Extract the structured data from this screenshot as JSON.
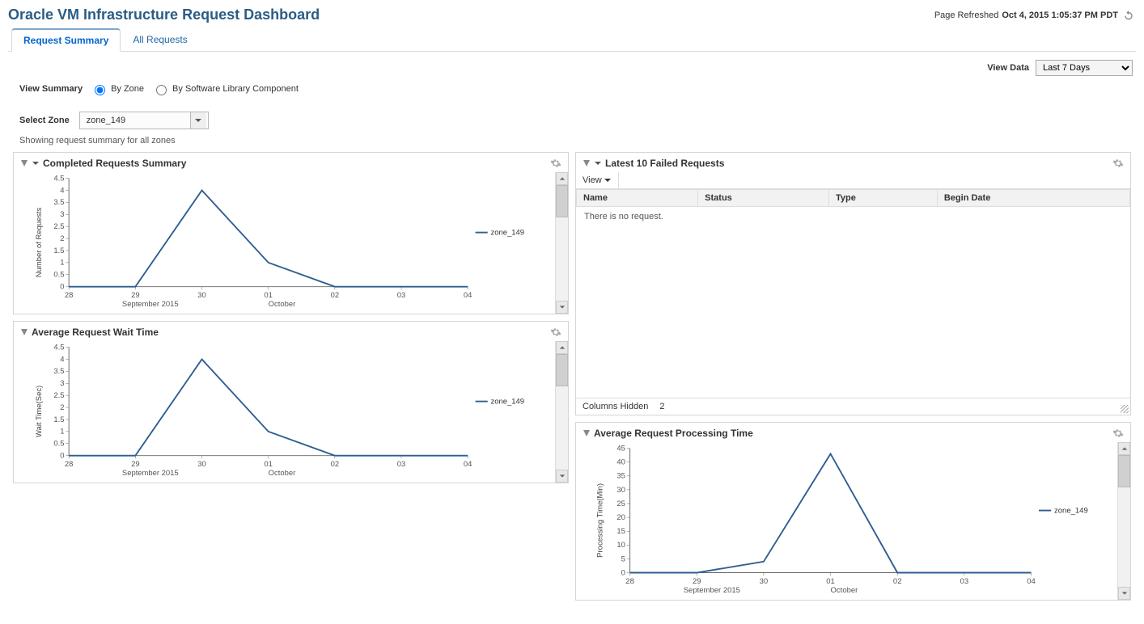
{
  "page": {
    "title": "Oracle VM Infrastructure Request Dashboard",
    "refresh_label": "Page Refreshed",
    "refresh_time": "Oct 4, 2015 1:05:37 PM PDT"
  },
  "tabs": [
    {
      "label": "Request Summary",
      "active": true
    },
    {
      "label": "All Requests",
      "active": false
    }
  ],
  "view_data": {
    "label": "View Data",
    "selected": "Last 7 Days"
  },
  "view_summary": {
    "label": "View Summary",
    "options": [
      {
        "label": "By Zone",
        "checked": true
      },
      {
        "label": "By Software Library Component",
        "checked": false
      }
    ]
  },
  "select_zone": {
    "label": "Select Zone",
    "value": "zone_149"
  },
  "note": "Showing request summary for all zones",
  "panels": {
    "completed": {
      "title": "Completed Requests Summary",
      "legend": "zone_149"
    },
    "wait_time": {
      "title": "Average Request Wait Time",
      "legend": "zone_149"
    },
    "failed": {
      "title": "Latest 10 Failed Requests",
      "view_label": "View",
      "columns": [
        "Name",
        "Status",
        "Type",
        "Begin Date"
      ],
      "empty_message": "There is no request.",
      "columns_hidden_label": "Columns Hidden",
      "columns_hidden_count": "2"
    },
    "processing": {
      "title": "Average Request Processing Time",
      "legend": "zone_149"
    }
  },
  "chart_data": [
    {
      "name": "completed",
      "type": "line",
      "title": "Completed Requests Summary",
      "ylabel": "Number of Requests",
      "xlabel": "",
      "x_groups": [
        "September 2015",
        "October"
      ],
      "categories": [
        "28",
        "29",
        "30",
        "01",
        "02",
        "03",
        "04"
      ],
      "series": [
        {
          "name": "zone_149",
          "values": [
            0,
            0,
            4,
            1,
            0,
            0,
            0
          ]
        }
      ],
      "ylim": [
        0,
        4.5
      ],
      "yticks": [
        0,
        0.5,
        1.0,
        1.5,
        2.0,
        2.5,
        3.0,
        3.5,
        4.0,
        4.5
      ]
    },
    {
      "name": "wait_time",
      "type": "line",
      "title": "Average Request Wait Time",
      "ylabel": "Wait Time(Sec)",
      "xlabel": "",
      "x_groups": [
        "September 2015",
        "October"
      ],
      "categories": [
        "28",
        "29",
        "30",
        "01",
        "02",
        "03",
        "04"
      ],
      "series": [
        {
          "name": "zone_149",
          "values": [
            0,
            0,
            4,
            1,
            0,
            0,
            0
          ]
        }
      ],
      "ylim": [
        0,
        4.5
      ],
      "yticks": [
        0,
        0.5,
        1.0,
        1.5,
        2.0,
        2.5,
        3.0,
        3.5,
        4.0,
        4.5
      ]
    },
    {
      "name": "processing",
      "type": "line",
      "title": "Average Request Processing Time",
      "ylabel": "Processing Time(Min)",
      "xlabel": "",
      "x_groups": [
        "September 2015",
        "October"
      ],
      "categories": [
        "28",
        "29",
        "30",
        "01",
        "02",
        "03",
        "04"
      ],
      "series": [
        {
          "name": "zone_149",
          "values": [
            0,
            0,
            4,
            43,
            0,
            0,
            0
          ]
        }
      ],
      "ylim": [
        0,
        45
      ],
      "yticks": [
        0,
        5,
        10,
        15,
        20,
        25,
        30,
        35,
        40,
        45
      ]
    }
  ]
}
